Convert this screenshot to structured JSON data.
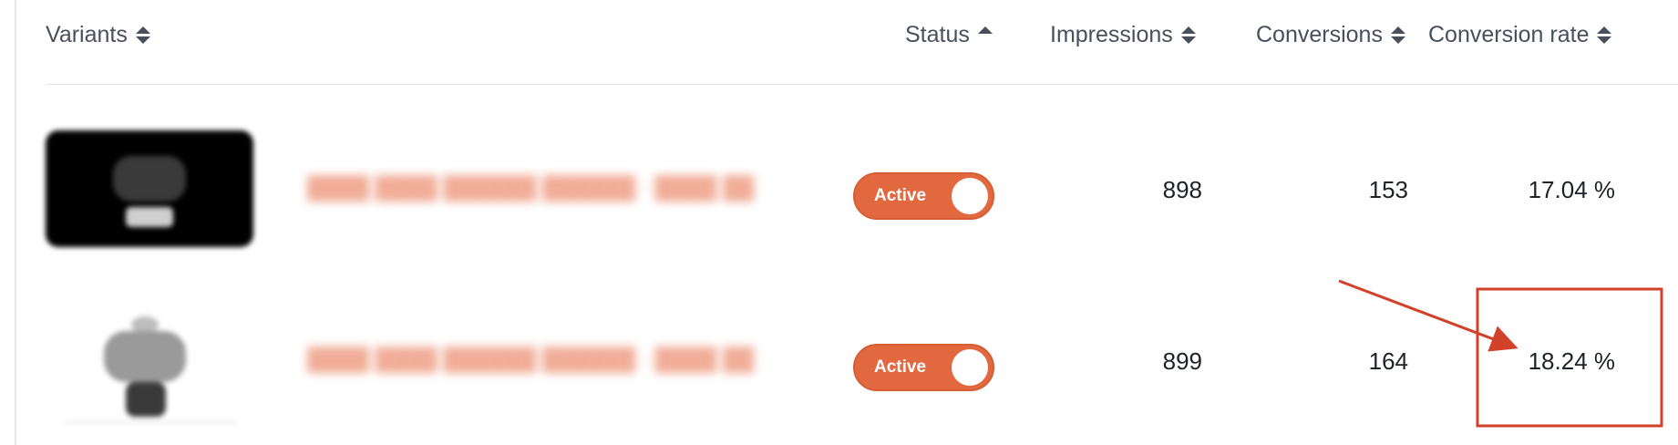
{
  "table": {
    "headers": {
      "variants": "Variants",
      "status": "Status",
      "impressions": "Impressions",
      "conversions": "Conversions",
      "conversion_rate": "Conversion rate"
    },
    "rows": [
      {
        "status": "Active",
        "status_on": true,
        "impressions": "898",
        "conversions": "153",
        "conversion_rate": "17.04 %"
      },
      {
        "status": "Active",
        "status_on": true,
        "impressions": "899",
        "conversions": "164",
        "conversion_rate": "18.24 %"
      }
    ]
  },
  "colors": {
    "accent": "#e2683f",
    "annotation": "#d2412a",
    "text": "#1f2229",
    "header_text": "#4a4f5c"
  },
  "icons": {
    "sort": "sort-icon",
    "sort_asc": "sort-ascending-icon"
  }
}
